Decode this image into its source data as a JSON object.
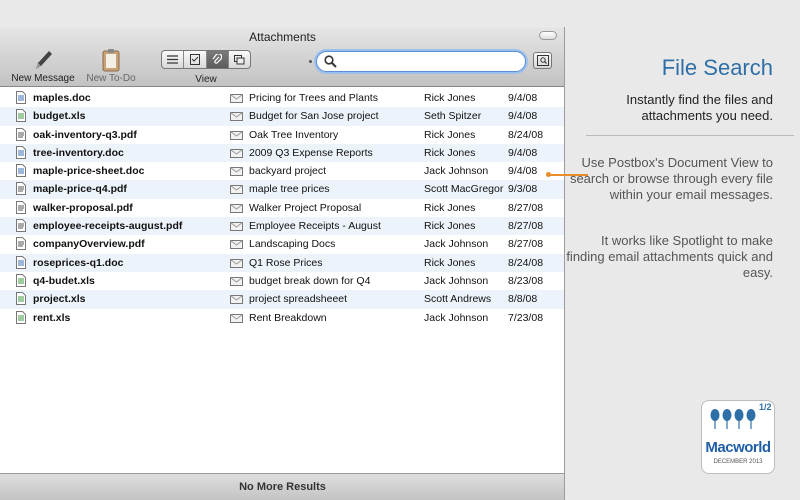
{
  "window": {
    "title": "Attachments"
  },
  "toolbar": {
    "new_message": "New Message",
    "new_todo": "New To-Do",
    "view_label": "View",
    "search": {
      "value": "",
      "placeholder": ""
    }
  },
  "files": [
    {
      "name": "maples.doc",
      "icon": "doc-icon",
      "subject": "Pricing for Trees and Plants",
      "from": "Rick Jones",
      "date": "9/4/08"
    },
    {
      "name": "budget.xls",
      "icon": "xls-icon",
      "subject": "Budget for San Jose project",
      "from": "Seth Spitzer",
      "date": "9/4/08"
    },
    {
      "name": "oak-inventory-q3.pdf",
      "icon": "pdf-icon",
      "subject": "Oak Tree Inventory",
      "from": "Rick Jones",
      "date": "8/24/08"
    },
    {
      "name": "tree-inventory.doc",
      "icon": "doc-icon",
      "subject": "2009 Q3 Expense Reports",
      "from": "Rick Jones",
      "date": "9/4/08"
    },
    {
      "name": "maple-price-sheet.doc",
      "icon": "doc-icon",
      "subject": "backyard project",
      "from": "Jack Johnson",
      "date": "9/4/08"
    },
    {
      "name": "maple-price-q4.pdf",
      "icon": "pdf-icon",
      "subject": "maple tree prices",
      "from": "Scott MacGregor",
      "date": "9/3/08"
    },
    {
      "name": "walker-proposal.pdf",
      "icon": "pdf-icon",
      "subject": "Walker Project Proposal",
      "from": "Rick Jones",
      "date": "8/27/08"
    },
    {
      "name": "employee-receipts-august.pdf",
      "icon": "pdf-icon",
      "subject": "Employee Receipts - August",
      "from": "Rick Jones",
      "date": "8/27/08"
    },
    {
      "name": "companyOverview.pdf",
      "icon": "pdf-icon",
      "subject": "Landscaping Docs",
      "from": "Jack Johnson",
      "date": "8/27/08"
    },
    {
      "name": "roseprices-q1.doc",
      "icon": "doc-icon",
      "subject": "Q1 Rose Prices",
      "from": "Rick Jones",
      "date": "8/24/08"
    },
    {
      "name": "q4-budet.xls",
      "icon": "xls-icon",
      "subject": "budget break down for Q4",
      "from": "Jack Johnson",
      "date": "8/23/08"
    },
    {
      "name": "project.xls",
      "icon": "xls-icon",
      "subject": "project spreadsheeet",
      "from": "Scott Andrews",
      "date": "8/8/08"
    },
    {
      "name": "rent.xls",
      "icon": "xls-icon",
      "subject": "Rent Breakdown",
      "from": "Jack Johnson",
      "date": "7/23/08"
    }
  ],
  "footer": {
    "status": "No More Results"
  },
  "marketing": {
    "heading": "File Search",
    "subheading": "Instantly find the files and attachments you need.",
    "paragraph1": "Use Postbox's Document View to search or browse through every file within your email messages.",
    "paragraph2": "It works like Spotlight to make finding email attachments quick and easy.",
    "accent_color": "#2f6fa8",
    "callout_color": "#e88d2b"
  },
  "award": {
    "brand": "Macworld",
    "rating": "4½",
    "half": "1/2",
    "date": "DECEMBER 2013"
  }
}
